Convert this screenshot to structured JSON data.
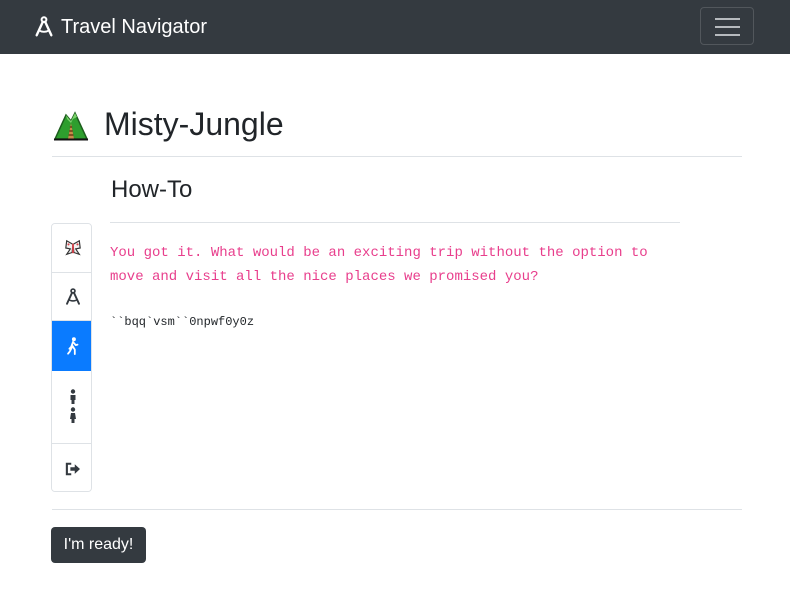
{
  "navbar": {
    "brand": "Travel Navigator",
    "brand_icon": "compass-drafting-icon",
    "menu_icon": "hamburger-menu-icon",
    "background": "#343a40"
  },
  "page": {
    "title": "Misty-Jungle",
    "title_icon": "mountain-railway-emoji-icon"
  },
  "sidebar": {
    "items": [
      {
        "name": "moth-icon",
        "active": false
      },
      {
        "name": "compass-icon",
        "active": false
      },
      {
        "name": "walking-person-icon",
        "active": true
      },
      {
        "name": "people-icon",
        "active": false
      },
      {
        "name": "sign-out-icon",
        "active": false
      }
    ],
    "active_color": "#0a7bff"
  },
  "content": {
    "heading": "How-To",
    "message": "You got it. What would be an exciting trip without the option to move and visit all the nice places we promised you?",
    "message_color": "#e83e8c",
    "code": "``bqq`vsm``0npwf0y0z"
  },
  "footer": {
    "ready_label": "I'm ready!"
  }
}
